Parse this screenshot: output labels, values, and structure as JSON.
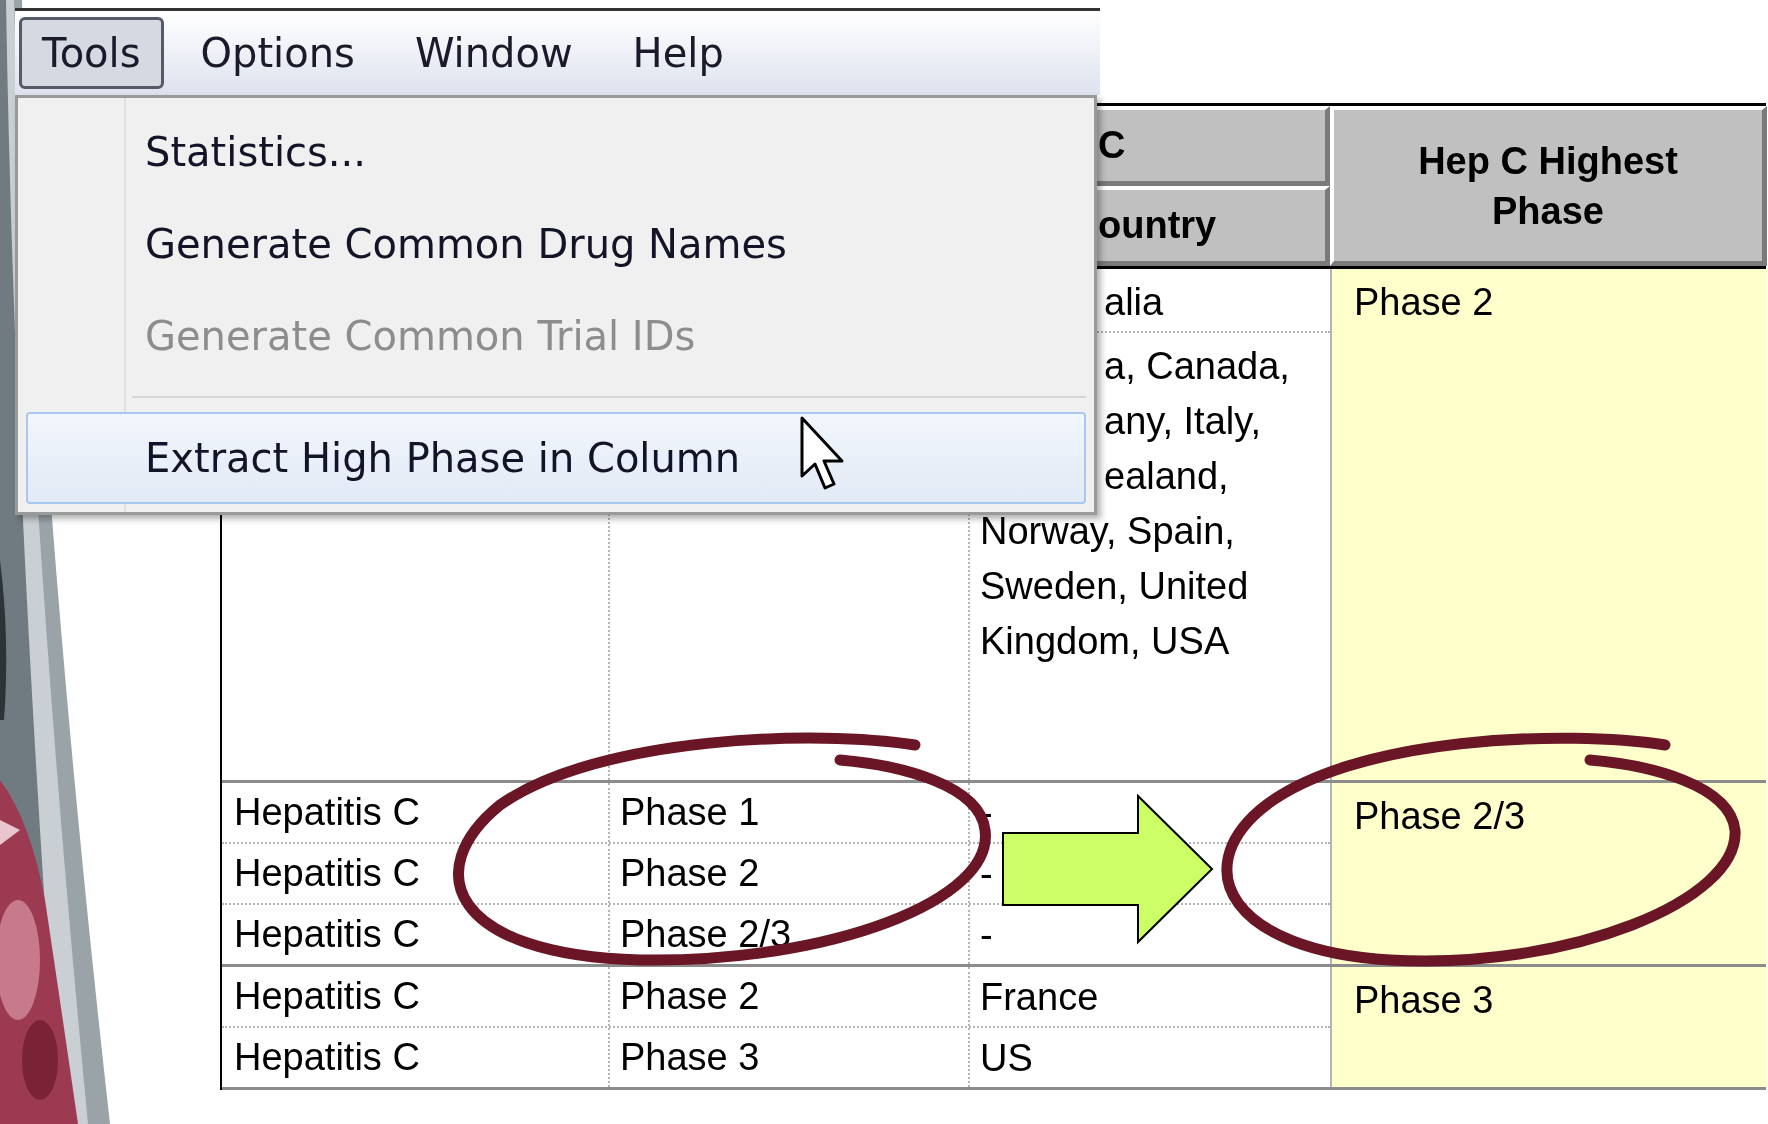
{
  "menu_bar": {
    "items": [
      {
        "label": "Tools",
        "selected": true
      },
      {
        "label": "Options",
        "selected": false
      },
      {
        "label": "Window",
        "selected": false
      },
      {
        "label": "Help",
        "selected": false
      }
    ]
  },
  "tools_menu": {
    "items": [
      {
        "kind": "item",
        "label": "Statistics...",
        "disabled": false,
        "selected": false
      },
      {
        "kind": "item",
        "label": "Generate Common Drug Names",
        "disabled": false,
        "selected": false
      },
      {
        "kind": "item",
        "label": "Generate Common Trial IDs",
        "disabled": true,
        "selected": false
      },
      {
        "kind": "separator"
      },
      {
        "kind": "item",
        "label": "Extract High Phase in Column",
        "disabled": false,
        "selected": true
      }
    ]
  },
  "table": {
    "header": {
      "column_3_top": "C",
      "column_3": "ountry",
      "column_4": "Hep C Highest Phase"
    },
    "groups": [
      {
        "rows": [
          {
            "column_3": [
              "alia"
            ]
          },
          {
            "column_3": [
              "a, Canada,",
              "any, Italy,",
              "ealand,",
              "Norway, Spain,",
              "Sweden, United",
              "Kingdom, USA"
            ]
          }
        ],
        "column_4": "Phase 2"
      },
      {
        "rows": [
          {
            "column_1": "Hepatitis C",
            "column_2": "Phase 1",
            "column_3": [
              "-"
            ]
          },
          {
            "column_1": "Hepatitis C",
            "column_2": "Phase 2",
            "column_3": [
              "-"
            ]
          },
          {
            "column_1": "Hepatitis C",
            "column_2": "Phase 2/3",
            "column_3": [
              "-"
            ]
          }
        ],
        "column_4": "Phase 2/3"
      },
      {
        "rows": [
          {
            "column_1": "Hepatitis C",
            "column_2": "Phase 2",
            "column_3": [
              "France"
            ]
          },
          {
            "column_1": "Hepatitis C",
            "column_2": "Phase 3",
            "column_3": [
              "US"
            ]
          }
        ],
        "column_4": "Phase 3"
      }
    ]
  }
}
